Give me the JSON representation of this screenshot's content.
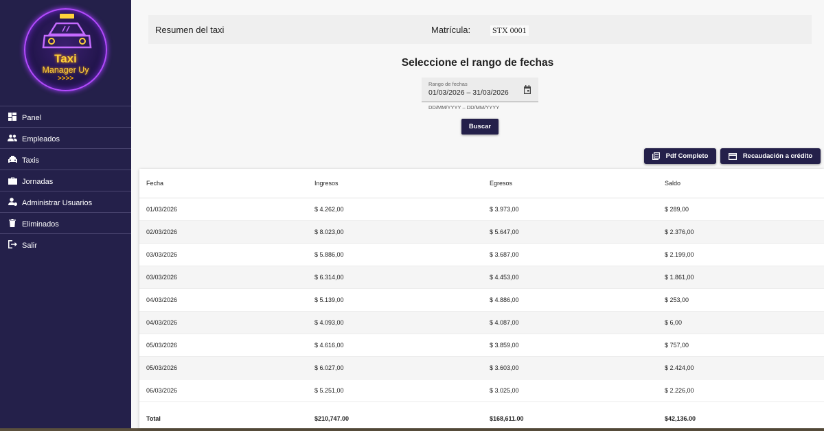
{
  "logo": {
    "line1": "Taxi",
    "line2": "Manager Uy",
    "line3": ">>>>"
  },
  "nav": [
    {
      "label": "Panel",
      "icon": "dashboard-icon"
    },
    {
      "label": "Empleados",
      "icon": "people-icon"
    },
    {
      "label": "Taxis",
      "icon": "taxi-icon"
    },
    {
      "label": "Jornadas",
      "icon": "briefcase-icon"
    },
    {
      "label": "Administrar Usuarios",
      "icon": "admin-user-icon"
    },
    {
      "label": "Eliminados",
      "icon": "trash-icon"
    },
    {
      "label": "Salir",
      "icon": "logout-icon"
    }
  ],
  "header": {
    "title": "Resumen del taxi",
    "matricula_label": "Matrícula:",
    "matricula_value": "STX 0001"
  },
  "range": {
    "title": "Seleccione el rango de fechas",
    "field_label": "Rango de fechas",
    "value": "01/03/2026  – 31/03/2026",
    "hint": "DD/MM/YYYY – DD/MM/YYYY",
    "search_button": "Buscar"
  },
  "actions": {
    "pdf": "Pdf Completo",
    "credit": "Recaudación a crédito"
  },
  "table": {
    "headers": [
      "Fecha",
      "Ingresos",
      "Egresos",
      "Saldo"
    ],
    "rows": [
      [
        "01/03/2026",
        "$ 4.262,00",
        "$ 3.973,00",
        "$ 289,00"
      ],
      [
        "02/03/2026",
        "$ 8.023,00",
        "$ 5.647,00",
        "$ 2.376,00"
      ],
      [
        "03/03/2026",
        "$ 5.886,00",
        "$ 3.687,00",
        "$ 2.199,00"
      ],
      [
        "03/03/2026",
        "$ 6.314,00",
        "$ 4.453,00",
        "$ 1.861,00"
      ],
      [
        "04/03/2026",
        "$ 5.139,00",
        "$ 4.886,00",
        "$ 253,00"
      ],
      [
        "04/03/2026",
        "$ 4.093,00",
        "$ 4.087,00",
        "$ 6,00"
      ],
      [
        "05/03/2026",
        "$ 4.616,00",
        "$ 3.859,00",
        "$ 757,00"
      ],
      [
        "05/03/2026",
        "$ 6.027,00",
        "$ 3.603,00",
        "$ 2.424,00"
      ],
      [
        "06/03/2026",
        "$ 5.251,00",
        "$ 3.025,00",
        "$ 2.226,00"
      ]
    ],
    "total": {
      "label": "Total",
      "ingresos": "$210,747.00",
      "egresos": "$168,611.00",
      "saldo": "$42,136.00"
    }
  },
  "colors": {
    "sidebar": "#24204a",
    "accent": "#24204a",
    "background": "#f7f7f7"
  }
}
